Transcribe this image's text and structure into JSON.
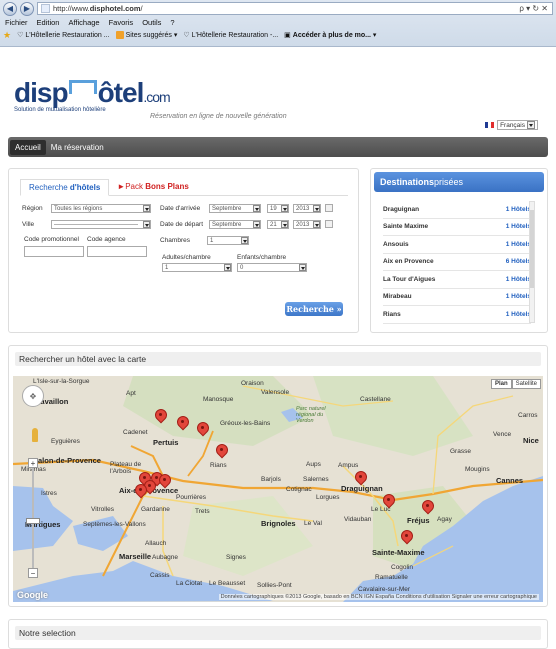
{
  "browser": {
    "url_prefix": "http://www.",
    "url_domain": "disphotel.com",
    "url_suffix": "/",
    "url_tools": "ρ ▾ ↻ ✕",
    "menu": [
      "Fichier",
      "Edition",
      "Affichage",
      "Favoris",
      "Outils",
      "?"
    ],
    "favorites": [
      "L'Hôtellerie Restauration ...",
      "Sites suggérés ▾",
      "L'Hôtellerie Restauration -...",
      "Accéder à plus de mo... ▾"
    ]
  },
  "header": {
    "logo_left": "disp",
    "logo_right": "ôtel",
    "logo_com": ".com",
    "logo_sub": "Solution de mutualisation hôtelière",
    "tagline": "Réservation en ligne de nouvelle génération",
    "language": "Français"
  },
  "nav": {
    "tabs": [
      "Accueil",
      "Ma réservation"
    ]
  },
  "search": {
    "tab_hotels_a": "Recherche ",
    "tab_hotels_b": "d'hôtels",
    "tab_pack_a": "►Pack ",
    "tab_pack_b": "Bons Plans",
    "region_label": "Région",
    "region_value": "Toutes les régions",
    "ville_label": "Ville",
    "ville_value": "——————————————",
    "promo_label": "Code promotionnel",
    "agence_label": "Code agence",
    "arrival_label": "Date d'arrivée",
    "arrival_month": "Septembre",
    "arrival_day": "19",
    "arrival_year": "2013",
    "depart_label": "Date de départ",
    "depart_month": "Septembre",
    "depart_day": "21",
    "depart_year": "2013",
    "rooms_label": "Chambres",
    "rooms_value": "1",
    "adults_label": "Adultes/chambre",
    "adults_value": "1",
    "children_label": "Enfants/chambre",
    "children_value": "0",
    "button": "Recherche »"
  },
  "destinations": {
    "title_a": "Destinations ",
    "title_b": "prisées",
    "items": [
      {
        "name": "Draguignan",
        "count": "1 Hôtels"
      },
      {
        "name": "Sainte Maxime",
        "count": "1 Hôtels"
      },
      {
        "name": "Ansouis",
        "count": "1 Hôtels"
      },
      {
        "name": "Aix en Provence",
        "count": "6 Hôtels"
      },
      {
        "name": "La Tour d'Aigues",
        "count": "1 Hôtels"
      },
      {
        "name": "Mirabeau",
        "count": "1 Hôtels"
      },
      {
        "name": "Rians",
        "count": "1 Hôtels"
      }
    ]
  },
  "map": {
    "title": "Rechercher un hôtel avec la carte",
    "btn_plan": "Plan",
    "btn_satellite": "Satellite",
    "footer": "Données cartographiques ©2013 Google, basado en BCN IGN España   Conditions d'utilisation   Signaler une erreur cartographique",
    "google": "Google",
    "labels": [
      "L'Isle-sur-la-Sorgue",
      "Cavaillon",
      "Apt",
      "Manosque",
      "Valensole",
      "Castellane",
      "Parc naturel régional du Verdon",
      "Cadenet",
      "Pertuis",
      "Gréoux-les-Bains",
      "Eyguières",
      "Salon-de-Provence",
      "Rians",
      "Aups",
      "Ampus",
      "Draguignan",
      "Grasse",
      "Vence",
      "Nice",
      "Carros",
      "Mougins",
      "Cannes",
      "Miramas",
      "Istres",
      "Aix-en-Provence",
      "Pourrières",
      "Barjols",
      "Salernes",
      "Cotignac",
      "Lorgues",
      "Le Luc",
      "Fréjus",
      "Agay",
      "Martigues",
      "Vitrolles",
      "Gardanne",
      "Trets",
      "Brignoles",
      "Le Val",
      "Vidauban",
      "Septèmes-les-Vallons",
      "Allauch",
      "Marseille",
      "Aubagne",
      "Signes",
      "Sainte-Maxime",
      "Cogolin",
      "Ramatuelle",
      "Cassis",
      "La Ciotat",
      "Le Beausset",
      "Sollies-Pont",
      "Cavalaire-sur-Mer",
      "Plateau de l'Arbois",
      "Oraison"
    ]
  },
  "selection": {
    "title": "Notre selection"
  }
}
